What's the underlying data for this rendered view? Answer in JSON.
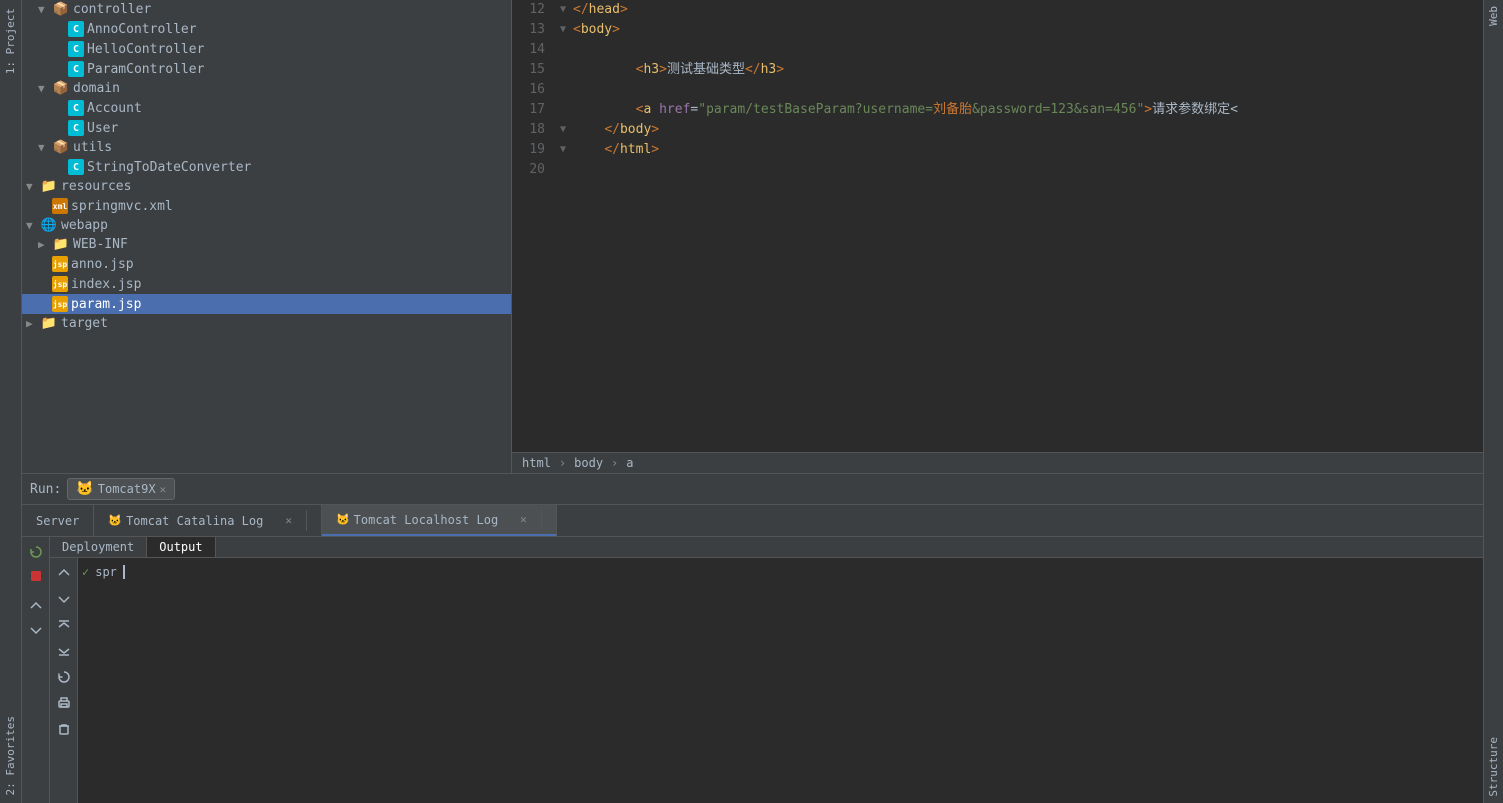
{
  "verticalTabs": {
    "label1": "1: Project",
    "label2": "2: Favorites"
  },
  "projectTree": {
    "items": [
      {
        "id": "controller",
        "label": "controller",
        "type": "package",
        "indent": 1,
        "expanded": true,
        "arrow": "open"
      },
      {
        "id": "AnnoController",
        "label": "AnnoController",
        "type": "class",
        "indent": 2,
        "arrow": "empty"
      },
      {
        "id": "HelloController",
        "label": "HelloController",
        "type": "class",
        "indent": 2,
        "arrow": "empty"
      },
      {
        "id": "ParamController",
        "label": "ParamController",
        "type": "class",
        "indent": 2,
        "arrow": "empty"
      },
      {
        "id": "domain",
        "label": "domain",
        "type": "package",
        "indent": 1,
        "expanded": true,
        "arrow": "open"
      },
      {
        "id": "Account",
        "label": "Account",
        "type": "class",
        "indent": 2,
        "arrow": "empty"
      },
      {
        "id": "User",
        "label": "User",
        "type": "class",
        "indent": 2,
        "arrow": "empty"
      },
      {
        "id": "utils",
        "label": "utils",
        "type": "package",
        "indent": 1,
        "expanded": true,
        "arrow": "open"
      },
      {
        "id": "StringToDateConverter",
        "label": "StringToDateConverter",
        "type": "class",
        "indent": 2,
        "arrow": "empty"
      },
      {
        "id": "resources",
        "label": "resources",
        "type": "folder",
        "indent": 0,
        "expanded": true,
        "arrow": "open"
      },
      {
        "id": "springmvc.xml",
        "label": "springmvc.xml",
        "type": "xml",
        "indent": 1,
        "arrow": "empty"
      },
      {
        "id": "webapp",
        "label": "webapp",
        "type": "folder",
        "indent": 0,
        "expanded": true,
        "arrow": "open"
      },
      {
        "id": "WEB-INF",
        "label": "WEB-INF",
        "type": "folder",
        "indent": 1,
        "expanded": false,
        "arrow": "closed"
      },
      {
        "id": "anno.jsp",
        "label": "anno.jsp",
        "type": "jsp",
        "indent": 1,
        "arrow": "empty"
      },
      {
        "id": "index.jsp",
        "label": "index.jsp",
        "type": "jsp",
        "indent": 1,
        "arrow": "empty"
      },
      {
        "id": "param.jsp",
        "label": "param.jsp",
        "type": "jsp",
        "indent": 1,
        "arrow": "empty",
        "selected": true
      },
      {
        "id": "target",
        "label": "target",
        "type": "folder",
        "indent": 0,
        "expanded": false,
        "arrow": "closed"
      }
    ]
  },
  "editor": {
    "lines": [
      {
        "num": 12,
        "fold": "▼",
        "content": "    </head>",
        "tokens": [
          {
            "text": "    ",
            "class": ""
          },
          {
            "text": "</",
            "class": "tag-angle"
          },
          {
            "text": "head",
            "class": "html-tag"
          },
          {
            "text": ">",
            "class": "tag-angle"
          }
        ]
      },
      {
        "num": 13,
        "fold": "▼",
        "content": "    <body>",
        "tokens": [
          {
            "text": "    ",
            "class": ""
          },
          {
            "text": "<",
            "class": "tag-angle"
          },
          {
            "text": "body",
            "class": "html-tag"
          },
          {
            "text": ">",
            "class": "tag-angle"
          }
        ]
      },
      {
        "num": 14,
        "fold": "",
        "content": "",
        "tokens": []
      },
      {
        "num": 15,
        "fold": "",
        "content": "        <h3>测试基础类型</h3>",
        "tokens": [
          {
            "text": "        ",
            "class": ""
          },
          {
            "text": "<",
            "class": "tag-angle"
          },
          {
            "text": "h3",
            "class": "html-tag"
          },
          {
            "text": ">",
            "class": "tag-angle"
          },
          {
            "text": "测试基础类型",
            "class": "chinese-text"
          },
          {
            "text": "</",
            "class": "tag-angle"
          },
          {
            "text": "h3",
            "class": "html-tag"
          },
          {
            "text": ">",
            "class": "tag-angle"
          }
        ]
      },
      {
        "num": 16,
        "fold": "",
        "content": "",
        "tokens": []
      },
      {
        "num": 17,
        "fold": "",
        "content": "        <a href=\"param/testBaseParam?username=刘备胎&password=123&san=456\">请求参数绑定<",
        "tokens": [
          {
            "text": "        ",
            "class": ""
          },
          {
            "text": "<",
            "class": "tag-angle"
          },
          {
            "text": "a",
            "class": "html-tag"
          },
          {
            "text": " ",
            "class": ""
          },
          {
            "text": "href",
            "class": "attr-name"
          },
          {
            "text": "=",
            "class": ""
          },
          {
            "text": "\"param/testBaseParam?username=刘备胎&password=123&san=456\"",
            "class": "attr-val"
          },
          {
            "text": ">",
            "class": "tag-angle"
          },
          {
            "text": "请求参数绑定<",
            "class": "chinese-text"
          }
        ]
      },
      {
        "num": 18,
        "fold": "▼",
        "content": "    </body>",
        "tokens": [
          {
            "text": "    ",
            "class": ""
          },
          {
            "text": "</",
            "class": "tag-angle"
          },
          {
            "text": "body",
            "class": "html-tag"
          },
          {
            "text": ">",
            "class": "tag-angle"
          }
        ]
      },
      {
        "num": 19,
        "fold": "▼",
        "content": "    </html>",
        "tokens": [
          {
            "text": "    ",
            "class": ""
          },
          {
            "text": "</",
            "class": "tag-angle"
          },
          {
            "text": "html",
            "class": "html-tag"
          },
          {
            "text": ">",
            "class": "tag-angle"
          }
        ]
      },
      {
        "num": 20,
        "fold": "",
        "content": "",
        "tokens": []
      }
    ],
    "statusBar": {
      "breadcrumb": [
        "html",
        "body",
        "a"
      ]
    }
  },
  "bottomPanel": {
    "runLabel": "Run:",
    "runTab": "Tomcat9X",
    "tabs": [
      {
        "label": "Server",
        "active": false,
        "closable": false
      },
      {
        "label": "Tomcat Catalina Log",
        "active": false,
        "closable": true
      },
      {
        "label": "Tomcat Localhost Log",
        "active": true,
        "closable": true
      }
    ],
    "subTabs": [
      {
        "label": "Deployment",
        "active": false
      },
      {
        "label": "Output",
        "active": true
      }
    ],
    "output": {
      "items": [
        {
          "type": "deploy",
          "text": "spr",
          "checked": true
        }
      ]
    },
    "buttons": {
      "restart": "↻",
      "stop": "■",
      "up": "↑",
      "down": "↓",
      "scrollToTop": "⇈",
      "scrollToBottom": "⇊",
      "print": "🖨",
      "trash": "🗑"
    }
  },
  "sideLabels": {
    "web": "Web",
    "structure": "Structure"
  }
}
